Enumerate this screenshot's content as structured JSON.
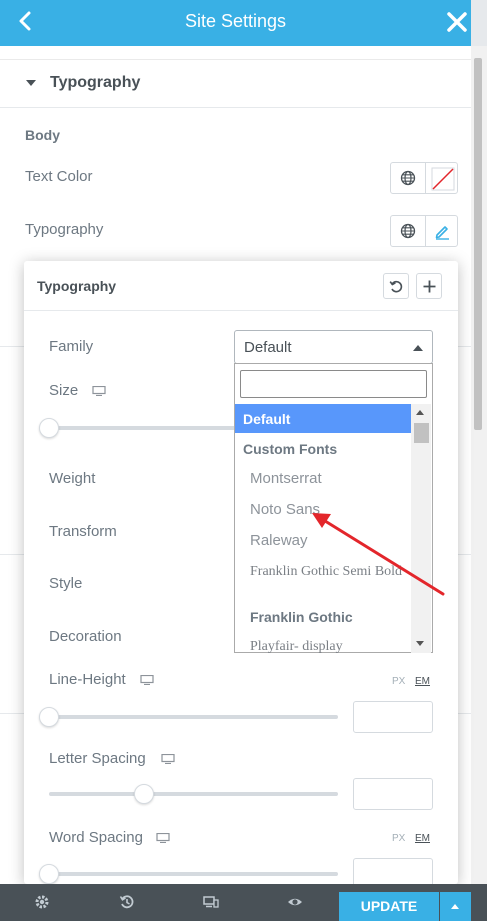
{
  "header": {
    "title": "Site Settings"
  },
  "section": {
    "title": "Typography"
  },
  "body": {
    "label": "Body",
    "text_color_label": "Text Color",
    "typography_label": "Typography"
  },
  "popover": {
    "title": "Typography",
    "family_label": "Family",
    "family_value": "Default",
    "size_label": "Size",
    "weight_label": "Weight",
    "transform_label": "Transform",
    "style_label": "Style",
    "decoration_label": "Decoration",
    "line_height_label": "Line-Height",
    "letter_spacing_label": "Letter Spacing",
    "word_spacing_label": "Word Spacing",
    "unit_px": "PX",
    "unit_em": "EM",
    "letter_spacing_level": 0.33
  },
  "dropdown": {
    "search_placeholder": "",
    "options": [
      {
        "label": "Default",
        "kind": "selected"
      },
      {
        "label": "Custom Fonts",
        "kind": "group"
      },
      {
        "label": "Montserrat",
        "kind": "item"
      },
      {
        "label": "Noto Sans",
        "kind": "item"
      },
      {
        "label": "Raleway",
        "kind": "item"
      },
      {
        "label": "Franklin Gothic Semi Bold",
        "kind": "serif"
      },
      {
        "label": "Franklin Gothic",
        "kind": "bold"
      },
      {
        "label": "Playfair- display",
        "kind": "serif"
      }
    ]
  },
  "footer": {
    "update_label": "UPDATE"
  },
  "colors": {
    "accent": "#39b0e5",
    "footer_bg": "#495157",
    "selected_option": "#5897fb",
    "annotation_arrow": "#e3262b"
  },
  "icons": [
    "chevron-left-icon",
    "close-icon",
    "globe-icon",
    "no-color-icon",
    "pencil-icon",
    "reset-icon",
    "plus-icon",
    "desktop-icon",
    "gear-icon",
    "history-icon",
    "responsive-icon",
    "eye-icon"
  ]
}
